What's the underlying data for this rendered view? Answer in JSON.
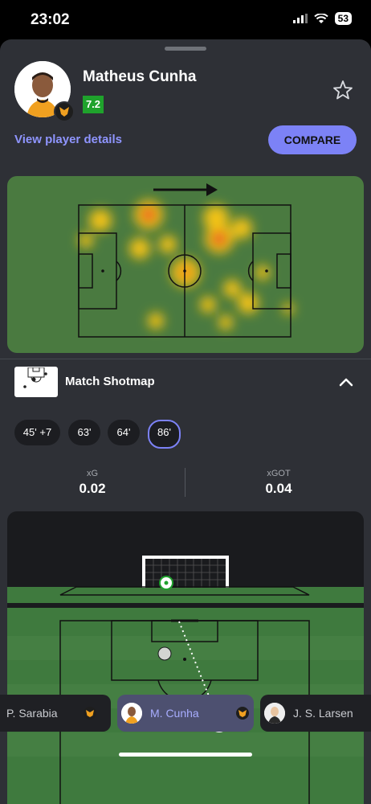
{
  "status_bar": {
    "time": "23:02",
    "battery": "53"
  },
  "player": {
    "name": "Matheus Cunha",
    "rating": "7.2",
    "details_link": "View player details",
    "compare_label": "COMPARE"
  },
  "shotmap": {
    "title": "Match Shotmap",
    "shots": [
      "45' +7",
      "63'",
      "64'",
      "86'"
    ],
    "selected_shot": "86'",
    "stats": [
      {
        "label": "xG",
        "value": "0.02"
      },
      {
        "label": "xGOT",
        "value": "0.04"
      }
    ]
  },
  "carousel": {
    "players": [
      {
        "name": "P. Sarabia",
        "active": false
      },
      {
        "name": "M. Cunha",
        "active": true
      },
      {
        "name": "J. S. Larsen",
        "active": false
      }
    ]
  },
  "colors": {
    "accent": "#7c82f6",
    "rating_green": "#1fa22c",
    "pitch_green": "#4a7a40",
    "sheet_bg": "#2e3036"
  },
  "icons": {
    "star": "star-icon",
    "collapse": "chevron-up-icon",
    "heatmap_direction": "arrow-right-icon"
  }
}
